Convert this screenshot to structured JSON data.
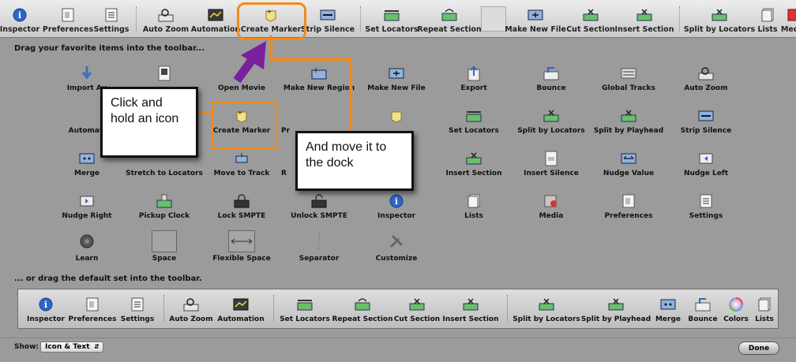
{
  "toolbar": {
    "items": [
      {
        "label": "Inspector",
        "icon": "info-icon"
      },
      {
        "label": "Preferences",
        "icon": "preferences-icon"
      },
      {
        "label": "Settings",
        "icon": "settings-icon"
      },
      {
        "label": "Auto Zoom",
        "icon": "zoom-icon"
      },
      {
        "label": "Automation",
        "icon": "automation-icon"
      },
      {
        "label": "Create Marker",
        "icon": "marker-icon"
      },
      {
        "label": "Strip Silence",
        "icon": "strip-silence-icon"
      },
      {
        "label": "Set Locators",
        "icon": "locators-icon"
      },
      {
        "label": "Repeat Section",
        "icon": "repeat-section-icon"
      },
      {
        "label": "Make New File",
        "icon": "new-file-icon"
      },
      {
        "label": "Cut Section",
        "icon": "cut-section-icon"
      },
      {
        "label": "Insert Section",
        "icon": "insert-section-icon"
      },
      {
        "label": "Split by Locators",
        "icon": "split-locators-icon"
      },
      {
        "label": "Lists",
        "icon": "lists-icon"
      },
      {
        "label": "Media",
        "icon": "media-icon"
      }
    ]
  },
  "sheet": {
    "instruction": "Drag your favorite items into the toolbar...",
    "default_instruction": "... or drag the default set into the toolbar."
  },
  "palette": [
    {
      "label": "Import Au",
      "icon": "import-audio-icon"
    },
    {
      "label": "",
      "icon": "open-movie-icon"
    },
    {
      "label": "Open Movie",
      "icon": ""
    },
    {
      "label": "Make New Region",
      "icon": "new-region-icon"
    },
    {
      "label": "Make New File",
      "icon": "new-file-icon"
    },
    {
      "label": "Export",
      "icon": "export-icon"
    },
    {
      "label": "Bounce",
      "icon": "bounce-icon"
    },
    {
      "label": "Global Tracks",
      "icon": "global-tracks-icon"
    },
    {
      "label": "Auto Zoom",
      "icon": "zoom-icon"
    },
    {
      "label": "Automati",
      "icon": "automation-icon"
    },
    {
      "label": "Create Marker",
      "icon": "marker-icon"
    },
    {
      "label": "Pr",
      "icon": ""
    },
    {
      "label": "",
      "icon": "marker-icon"
    },
    {
      "label": "Set Locators",
      "icon": "locators-icon"
    },
    {
      "label": "Split by Locators",
      "icon": "split-locators-icon"
    },
    {
      "label": "Split by Playhead",
      "icon": "split-playhead-icon"
    },
    {
      "label": "Strip Silence",
      "icon": "strip-silence-icon"
    },
    {
      "label": "Merge",
      "icon": "merge-icon"
    },
    {
      "label": "Stretch to Locators",
      "icon": "stretch-icon"
    },
    {
      "label": "Move to Track",
      "icon": "move-track-icon"
    },
    {
      "label": "R",
      "icon": ""
    },
    {
      "label": "Insert Section",
      "icon": "insert-section-icon"
    },
    {
      "label": "Insert Silence",
      "icon": "insert-silence-icon"
    },
    {
      "label": "Nudge Value",
      "icon": "nudge-value-icon"
    },
    {
      "label": "Nudge Left",
      "icon": "nudge-left-icon"
    },
    {
      "label": "Nudge Right",
      "icon": "nudge-right-icon"
    },
    {
      "label": "Pickup Clock",
      "icon": "pickup-clock-icon"
    },
    {
      "label": "Lock SMPTE",
      "icon": "lock-smpte-icon"
    },
    {
      "label": "Unlock SMPTE",
      "icon": "unlock-smpte-icon"
    },
    {
      "label": "Inspector",
      "icon": "info-icon"
    },
    {
      "label": "Lists",
      "icon": "lists-icon"
    },
    {
      "label": "Media",
      "icon": "media-icon"
    },
    {
      "label": "Preferences",
      "icon": "preferences-icon"
    },
    {
      "label": "Settings",
      "icon": "settings-icon"
    },
    {
      "label": "Learn",
      "icon": "learn-icon"
    },
    {
      "label": "Space",
      "icon": "space-icon"
    },
    {
      "label": "Flexible Space",
      "icon": "flexible-space-icon"
    },
    {
      "label": "Separator",
      "icon": "separator-icon"
    },
    {
      "label": "Customize",
      "icon": "customize-icon"
    }
  ],
  "default_set": {
    "items": [
      {
        "label": "Inspector",
        "icon": "info-icon"
      },
      {
        "label": "Preferences",
        "icon": "preferences-icon"
      },
      {
        "label": "Settings",
        "icon": "settings-icon"
      },
      {
        "label": "Auto Zoom",
        "icon": "zoom-icon"
      },
      {
        "label": "Automation",
        "icon": "automation-icon"
      },
      {
        "label": "Set Locators",
        "icon": "locators-icon"
      },
      {
        "label": "Repeat Section",
        "icon": "repeat-section-icon"
      },
      {
        "label": "Cut Section",
        "icon": "cut-section-icon"
      },
      {
        "label": "Insert Section",
        "icon": "insert-section-icon"
      },
      {
        "label": "Split by Locators",
        "icon": "split-locators-icon"
      },
      {
        "label": "Split by Playhead",
        "icon": "split-playhead-icon"
      },
      {
        "label": "Merge",
        "icon": "merge-icon"
      },
      {
        "label": "Bounce",
        "icon": "bounce-icon"
      },
      {
        "label": "Colors",
        "icon": "colors-icon"
      },
      {
        "label": "Lists",
        "icon": "lists-icon"
      }
    ]
  },
  "footer": {
    "show_label": "Show:",
    "show_value": "Icon & Text",
    "done_label": "Done"
  },
  "annotations": {
    "callout1": "Click and hold an icon",
    "callout2": "And move it to the dock",
    "orange": "#f08a1c",
    "purple": "#7a1f9e"
  }
}
